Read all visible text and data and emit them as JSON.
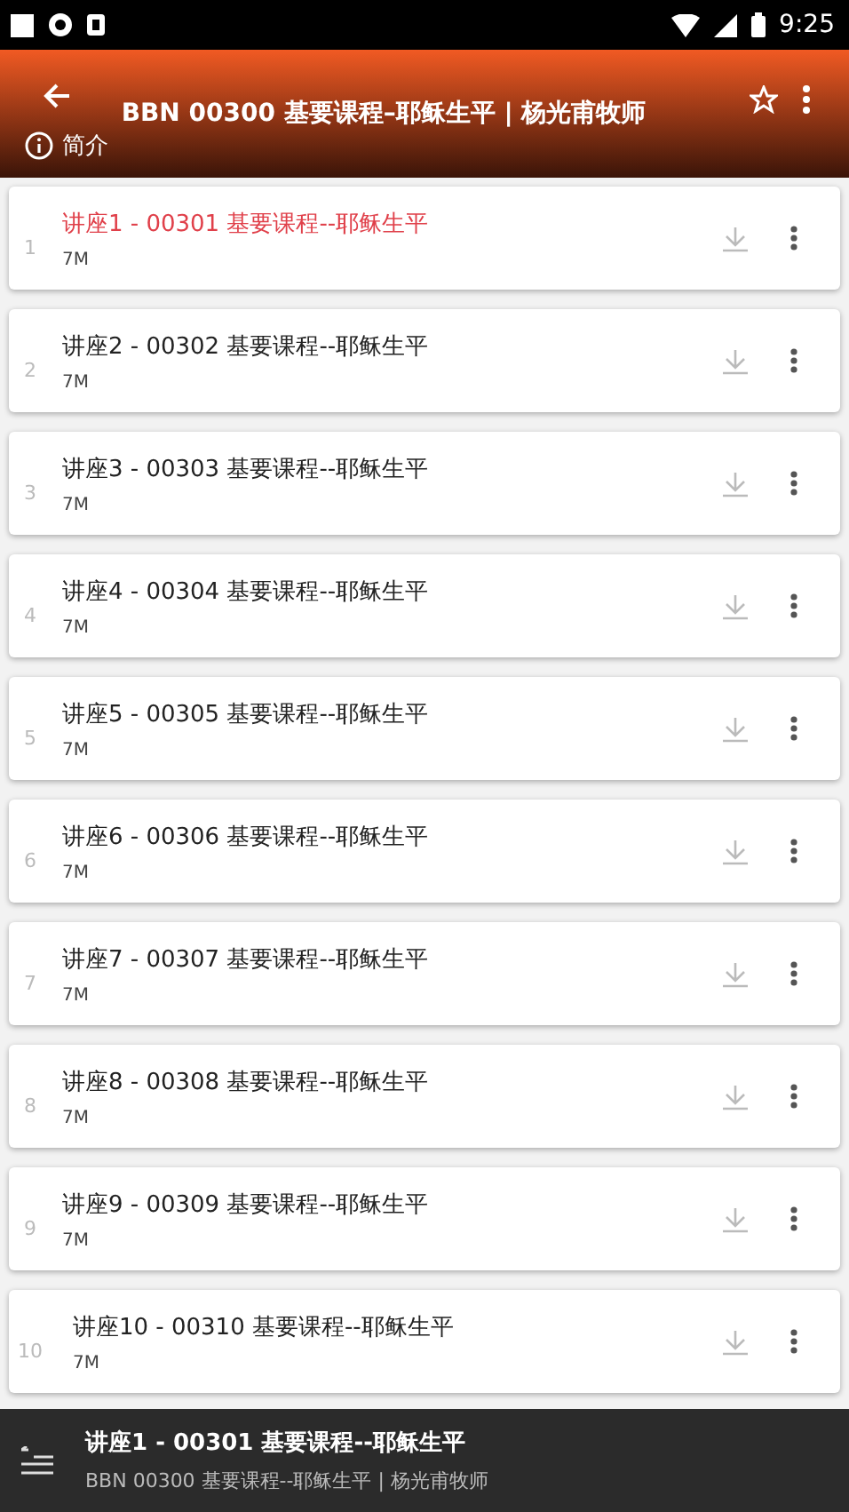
{
  "status_bar": {
    "time": "9:25"
  },
  "header": {
    "title": "BBN 00300 基要课程–耶稣生平 | 杨光甫牧师",
    "intro": "简介"
  },
  "lectures": [
    {
      "number": "1",
      "title": "讲座1 - 00301 基要课程--耶稣生平",
      "size": "7M",
      "selected": true
    },
    {
      "number": "2",
      "title": "讲座2 - 00302 基要课程--耶稣生平",
      "size": "7M",
      "selected": false
    },
    {
      "number": "3",
      "title": "讲座3 - 00303 基要课程--耶稣生平",
      "size": "7M",
      "selected": false
    },
    {
      "number": "4",
      "title": "讲座4 - 00304 基要课程--耶稣生平",
      "size": "7M",
      "selected": false
    },
    {
      "number": "5",
      "title": "讲座5 - 00305 基要课程--耶稣生平",
      "size": "7M",
      "selected": false
    },
    {
      "number": "6",
      "title": "讲座6 - 00306 基要课程--耶稣生平",
      "size": "7M",
      "selected": false
    },
    {
      "number": "7",
      "title": "讲座7 - 00307 基要课程--耶稣生平",
      "size": "7M",
      "selected": false
    },
    {
      "number": "8",
      "title": "讲座8 - 00308 基要课程--耶稣生平",
      "size": "7M",
      "selected": false
    },
    {
      "number": "9",
      "title": "讲座9 - 00309 基要课程--耶稣生平",
      "size": "7M",
      "selected": false
    },
    {
      "number": "10",
      "title": "讲座10 - 00310 基要课程--耶稣生平",
      "size": "7M",
      "selected": false
    }
  ],
  "player": {
    "title": "讲座1 - 00301 基要课程--耶稣生平",
    "subtitle": "BBN 00300 基要课程--耶稣生平 | 杨光甫牧师"
  }
}
